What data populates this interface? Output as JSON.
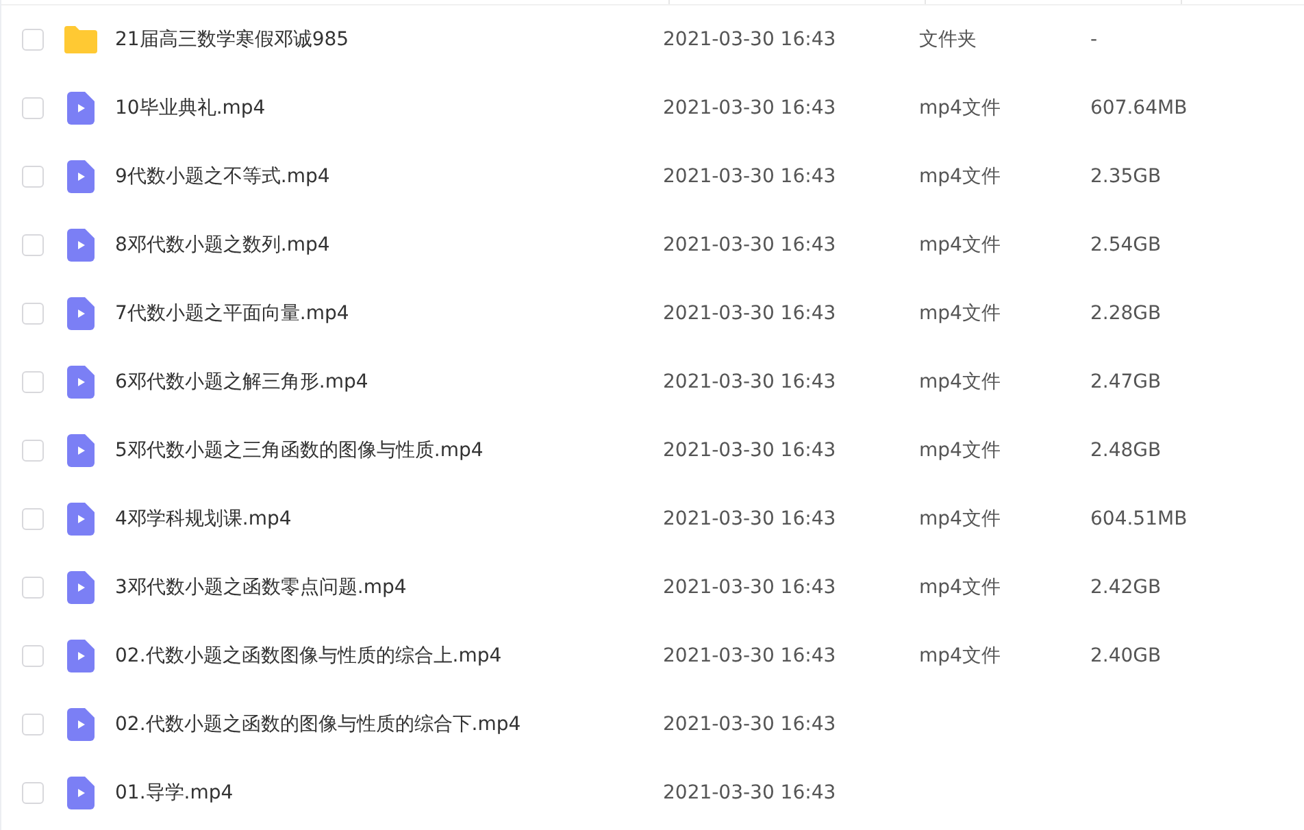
{
  "files": [
    {
      "kind": "folder",
      "name": "21届高三数学寒假邓诚985",
      "modified": "2021-03-30 16:43",
      "type": "文件夹",
      "size": "-",
      "checked": false
    },
    {
      "kind": "video",
      "name": "10毕业典礼.mp4",
      "modified": "2021-03-30 16:43",
      "type": "mp4文件",
      "size": "607.64MB",
      "checked": false
    },
    {
      "kind": "video",
      "name": "9代数小题之不等式.mp4",
      "modified": "2021-03-30 16:43",
      "type": "mp4文件",
      "size": "2.35GB",
      "checked": false
    },
    {
      "kind": "video",
      "name": "8邓代数小题之数列.mp4",
      "modified": "2021-03-30 16:43",
      "type": "mp4文件",
      "size": "2.54GB",
      "checked": false
    },
    {
      "kind": "video",
      "name": "7代数小题之平面向量.mp4",
      "modified": "2021-03-30 16:43",
      "type": "mp4文件",
      "size": "2.28GB",
      "checked": false
    },
    {
      "kind": "video",
      "name": "6邓代数小题之解三角形.mp4",
      "modified": "2021-03-30 16:43",
      "type": "mp4文件",
      "size": "2.47GB",
      "checked": false
    },
    {
      "kind": "video",
      "name": "5邓代数小题之三角函数的图像与性质.mp4",
      "modified": "2021-03-30 16:43",
      "type": "mp4文件",
      "size": "2.48GB",
      "checked": false
    },
    {
      "kind": "video",
      "name": "4邓学科规划课.mp4",
      "modified": "2021-03-30 16:43",
      "type": "mp4文件",
      "size": "604.51MB",
      "checked": false
    },
    {
      "kind": "video",
      "name": "3邓代数小题之函数零点问题.mp4",
      "modified": "2021-03-30 16:43",
      "type": "mp4文件",
      "size": "2.42GB",
      "checked": false
    },
    {
      "kind": "video",
      "name": "02.代数小题之函数图像与性质的综合上.mp4",
      "modified": "2021-03-30 16:43",
      "type": "mp4文件",
      "size": "2.40GB",
      "checked": false
    },
    {
      "kind": "video",
      "name": "02.代数小题之函数的图像与性质的综合下.mp4",
      "modified": "2021-03-30 16:43",
      "checked": false
    },
    {
      "kind": "video",
      "name": "01.导学.mp4",
      "modified": "2021-03-30 16:43",
      "checked": false
    }
  ]
}
